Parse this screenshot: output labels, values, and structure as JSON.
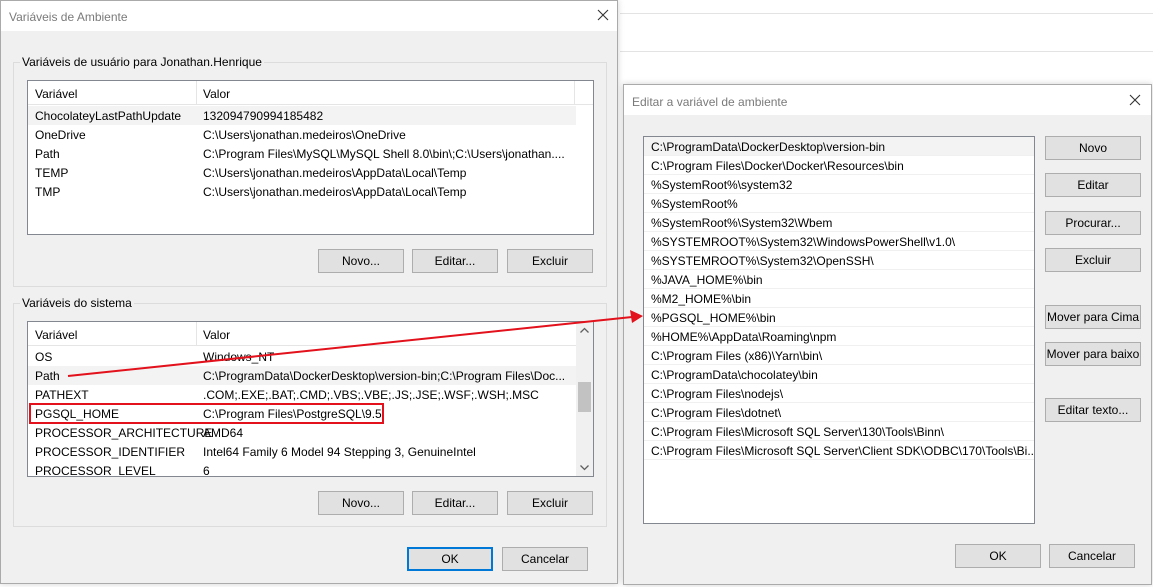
{
  "left_dialog": {
    "title": "Variáveis de Ambiente",
    "user_group_label": "Variáveis de usuário para Jonathan.Henrique",
    "system_group_label": "Variáveis do sistema",
    "col_variable": "Variável",
    "col_value": "Valor",
    "user_vars": [
      {
        "name": "ChocolateyLastPathUpdate",
        "value": "132094790994185482"
      },
      {
        "name": "OneDrive",
        "value": "C:\\Users\\jonathan.medeiros\\OneDrive"
      },
      {
        "name": "Path",
        "value": "C:\\Program Files\\MySQL\\MySQL Shell 8.0\\bin\\;C:\\Users\\jonathan...."
      },
      {
        "name": "TEMP",
        "value": "C:\\Users\\jonathan.medeiros\\AppData\\Local\\Temp"
      },
      {
        "name": "TMP",
        "value": "C:\\Users\\jonathan.medeiros\\AppData\\Local\\Temp"
      }
    ],
    "system_vars": [
      {
        "name": "OS",
        "value": "Windows_NT"
      },
      {
        "name": "Path",
        "value": "C:\\ProgramData\\DockerDesktop\\version-bin;C:\\Program Files\\Doc..."
      },
      {
        "name": "PATHEXT",
        "value": ".COM;.EXE;.BAT;.CMD;.VBS;.VBE;.JS;.JSE;.WSF;.WSH;.MSC"
      },
      {
        "name": "PGSQL_HOME",
        "value": "C:\\Program Files\\PostgreSQL\\9.5"
      },
      {
        "name": "PROCESSOR_ARCHITECTURE",
        "value": "AMD64"
      },
      {
        "name": "PROCESSOR_IDENTIFIER",
        "value": "Intel64 Family 6 Model 94 Stepping 3, GenuineIntel"
      },
      {
        "name": "PROCESSOR_LEVEL",
        "value": "6"
      }
    ],
    "btn_new": "Novo...",
    "btn_edit": "Editar...",
    "btn_delete": "Excluir",
    "btn_ok": "OK",
    "btn_cancel": "Cancelar"
  },
  "right_dialog": {
    "title": "Editar a variável de ambiente",
    "path_entries": [
      "C:\\ProgramData\\DockerDesktop\\version-bin",
      "C:\\Program Files\\Docker\\Docker\\Resources\\bin",
      "%SystemRoot%\\system32",
      "%SystemRoot%",
      "%SystemRoot%\\System32\\Wbem",
      "%SYSTEMROOT%\\System32\\WindowsPowerShell\\v1.0\\",
      "%SYSTEMROOT%\\System32\\OpenSSH\\",
      "%JAVA_HOME%\\bin",
      "%M2_HOME%\\bin",
      "%PGSQL_HOME%\\bin",
      "%HOME%\\AppData\\Roaming\\npm",
      "C:\\Program Files (x86)\\Yarn\\bin\\",
      "C:\\ProgramData\\chocolatey\\bin",
      "C:\\Program Files\\nodejs\\",
      "C:\\Program Files\\dotnet\\",
      "C:\\Program Files\\Microsoft SQL Server\\130\\Tools\\Binn\\",
      "C:\\Program Files\\Microsoft SQL Server\\Client SDK\\ODBC\\170\\Tools\\Bi..."
    ],
    "btn_new": "Novo",
    "btn_edit": "Editar",
    "btn_browse": "Procurar...",
    "btn_delete": "Excluir",
    "btn_move_up": "Mover para Cima",
    "btn_move_down": "Mover para baixo",
    "btn_edit_text": "Editar texto...",
    "btn_ok": "OK",
    "btn_cancel": "Cancelar"
  },
  "colors": {
    "annotation_red": "#e2111b",
    "default_button_border": "#0078d7"
  }
}
